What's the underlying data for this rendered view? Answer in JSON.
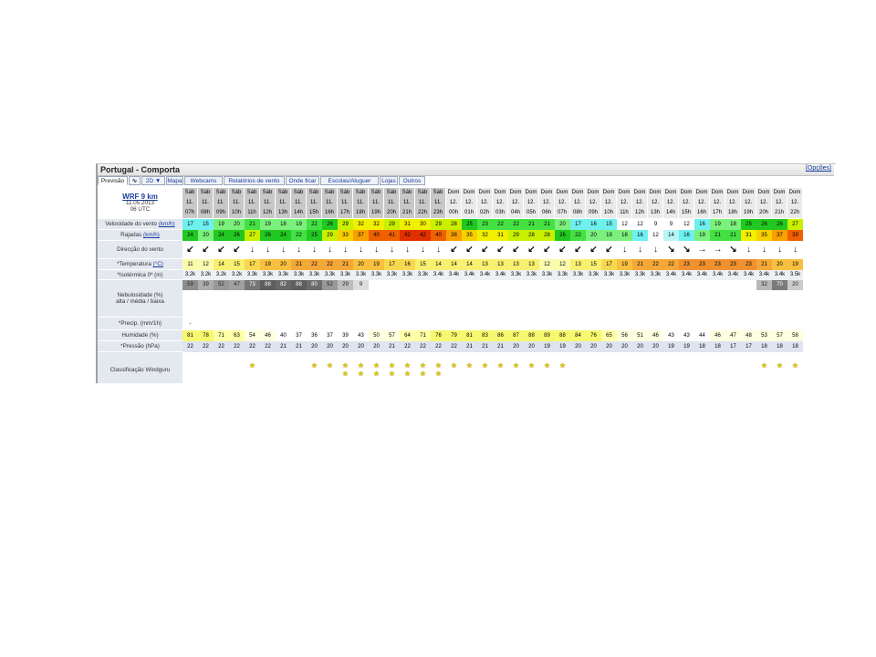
{
  "window": {
    "title": "Portugal - Comporta",
    "options_link": "[Opções]"
  },
  "tabs": [
    "Previsão",
    "",
    "2D ▼",
    "Mapa",
    "Webcams",
    "Relatórios de vento",
    "Onde ficar",
    "Escolas/Aluguer",
    "Lojas",
    "Outros"
  ],
  "model": {
    "name": "WRF 9 km",
    "date": "11.05.2013",
    "utc": "06 UTC"
  },
  "row_labels": {
    "wind_speed": "Velocidade do vento",
    "wind_unit": "(km/h)",
    "gusts": "Rajadas",
    "gust_unit": "(km/h)",
    "direction": "Direcção do vento",
    "temperature": "*Temperatura",
    "temp_unit": "(°C)",
    "isotherm": "*Isotérmica 0º (m)",
    "clouds": "Nebulosidade (%)",
    "clouds_sub": "alta / média / baixa",
    "precip": "*Precip. (mm/1h)",
    "humidity": "Humidade (%)",
    "pressure": "*Pressão (hPa)",
    "rating": "Classificação Windguru"
  },
  "hours": [
    {
      "d": "Sáb",
      "n": "11.",
      "h": "07h"
    },
    {
      "d": "Sáb",
      "n": "11.",
      "h": "08h"
    },
    {
      "d": "Sáb",
      "n": "11.",
      "h": "09h"
    },
    {
      "d": "Sáb",
      "n": "11.",
      "h": "10h"
    },
    {
      "d": "Sáb",
      "n": "11.",
      "h": "11h"
    },
    {
      "d": "Sáb",
      "n": "11.",
      "h": "12h"
    },
    {
      "d": "Sáb",
      "n": "11.",
      "h": "13h"
    },
    {
      "d": "Sáb",
      "n": "11.",
      "h": "14h"
    },
    {
      "d": "Sáb",
      "n": "11.",
      "h": "15h"
    },
    {
      "d": "Sáb",
      "n": "11.",
      "h": "16h"
    },
    {
      "d": "Sáb",
      "n": "11.",
      "h": "17h"
    },
    {
      "d": "Sáb",
      "n": "11.",
      "h": "18h"
    },
    {
      "d": "Sáb",
      "n": "11.",
      "h": "19h"
    },
    {
      "d": "Sáb",
      "n": "11.",
      "h": "20h"
    },
    {
      "d": "Sáb",
      "n": "11.",
      "h": "21h"
    },
    {
      "d": "Sáb",
      "n": "11.",
      "h": "22h"
    },
    {
      "d": "Sáb",
      "n": "11.",
      "h": "23h"
    },
    {
      "d": "Dom",
      "n": "12.",
      "h": "00h"
    },
    {
      "d": "Dom",
      "n": "12.",
      "h": "01h"
    },
    {
      "d": "Dom",
      "n": "12.",
      "h": "02h"
    },
    {
      "d": "Dom",
      "n": "12.",
      "h": "03h"
    },
    {
      "d": "Dom",
      "n": "12.",
      "h": "04h"
    },
    {
      "d": "Dom",
      "n": "12.",
      "h": "05h"
    },
    {
      "d": "Dom",
      "n": "12.",
      "h": "06h"
    },
    {
      "d": "Dom",
      "n": "12.",
      "h": "07h"
    },
    {
      "d": "Dom",
      "n": "12.",
      "h": "08h"
    },
    {
      "d": "Dom",
      "n": "12.",
      "h": "09h"
    },
    {
      "d": "Dom",
      "n": "12.",
      "h": "10h"
    },
    {
      "d": "Dom",
      "n": "12.",
      "h": "11h"
    },
    {
      "d": "Dom",
      "n": "12.",
      "h": "12h"
    },
    {
      "d": "Dom",
      "n": "12.",
      "h": "13h"
    },
    {
      "d": "Dom",
      "n": "12.",
      "h": "14h"
    },
    {
      "d": "Dom",
      "n": "12.",
      "h": "15h"
    },
    {
      "d": "Dom",
      "n": "12.",
      "h": "16h"
    },
    {
      "d": "Dom",
      "n": "12.",
      "h": "17h"
    },
    {
      "d": "Dom",
      "n": "12.",
      "h": "18h"
    },
    {
      "d": "Dom",
      "n": "12.",
      "h": "19h"
    },
    {
      "d": "Dom",
      "n": "12.",
      "h": "20h"
    },
    {
      "d": "Dom",
      "n": "12.",
      "h": "21h"
    },
    {
      "d": "Dom",
      "n": "12.",
      "h": "22h"
    }
  ],
  "wind_speed": [
    "17",
    "15",
    "19",
    "20",
    "21",
    "19",
    "18",
    "19",
    "22",
    "26",
    "29",
    "32",
    "32",
    "29",
    "31",
    "30",
    "29",
    "28",
    "25",
    "23",
    "22",
    "22",
    "21",
    "21",
    "20",
    "17",
    "16",
    "15",
    "12",
    "12",
    "9",
    "9",
    "12",
    "16",
    "19",
    "18",
    "25",
    "26",
    "26",
    "27"
  ],
  "gusts": [
    "24",
    "20",
    "24",
    "26",
    "27",
    "26",
    "24",
    "22",
    "25",
    "29",
    "33",
    "37",
    "40",
    "41",
    "42",
    "42",
    "40",
    "38",
    "35",
    "32",
    "31",
    "29",
    "28",
    "28",
    "26",
    "22",
    "20",
    "19",
    "18",
    "16",
    "12",
    "14",
    "16",
    "19",
    "21",
    "21",
    "31",
    "35",
    "37",
    "39"
  ],
  "direction": [
    "↙",
    "↙",
    "↙",
    "↙",
    "↓",
    "↓",
    "↓",
    "↓",
    "↓",
    "↓",
    "↓",
    "↓",
    "↓",
    "↓",
    "↓",
    "↓",
    "↓",
    "↙",
    "↙",
    "↙",
    "↙",
    "↙",
    "↙",
    "↙",
    "↙",
    "↙",
    "↙",
    "↙",
    "↓",
    "↓",
    "↓",
    "↘",
    "↘",
    "→",
    "→",
    "↘",
    "↓",
    "↓",
    "↓",
    "↓"
  ],
  "temperature": [
    "11",
    "12",
    "14",
    "15",
    "17",
    "19",
    "20",
    "21",
    "22",
    "22",
    "21",
    "20",
    "19",
    "17",
    "16",
    "15",
    "14",
    "14",
    "14",
    "13",
    "13",
    "13",
    "13",
    "12",
    "12",
    "13",
    "15",
    "17",
    "19",
    "21",
    "22",
    "22",
    "23",
    "23",
    "23",
    "23",
    "23",
    "21",
    "20",
    "19"
  ],
  "isotherm": [
    "3.2k",
    "3.2k",
    "3.2k",
    "3.2k",
    "3.3k",
    "3.3k",
    "3.3k",
    "3.3k",
    "3.3k",
    "3.3k",
    "3.3k",
    "3.3k",
    "3.3k",
    "3.3k",
    "3.3k",
    "3.3k",
    "3.4k",
    "3.4k",
    "3.4k",
    "3.4k",
    "3.4k",
    "3.3k",
    "3.3k",
    "3.3k",
    "3.3k",
    "3.3k",
    "3.3k",
    "3.3k",
    "3.3k",
    "3.3k",
    "3.3k",
    "3.4k",
    "3.4k",
    "3.4k",
    "3.4k",
    "3.4k",
    "3.4k",
    "3.4k",
    "3.4k",
    "3.5k"
  ],
  "clouds": [
    "59",
    "39",
    "52",
    "47",
    "73",
    "88",
    "82",
    "88",
    "80",
    "52",
    "29",
    "9",
    "",
    "",
    "",
    "",
    "",
    "",
    "",
    "",
    "",
    "",
    "",
    "",
    "",
    "",
    "",
    "",
    "",
    "",
    "",
    "",
    "",
    "",
    "",
    "",
    "",
    "32",
    "70",
    "20"
  ],
  "precip": [
    "-",
    "",
    "",
    "",
    "",
    "",
    "",
    "",
    "",
    "",
    "",
    "",
    "",
    "",
    "",
    "",
    "",
    "",
    "",
    "",
    "",
    "",
    "",
    "",
    "",
    "",
    "",
    "",
    "",
    "",
    "",
    "",
    "",
    "",
    "",
    "",
    "",
    "",
    "",
    ""
  ],
  "humidity": [
    "81",
    "78",
    "71",
    "63",
    "54",
    "46",
    "40",
    "37",
    "36",
    "37",
    "39",
    "43",
    "50",
    "57",
    "64",
    "71",
    "76",
    "79",
    "81",
    "83",
    "86",
    "87",
    "88",
    "89",
    "88",
    "84",
    "76",
    "65",
    "56",
    "51",
    "46",
    "43",
    "43",
    "44",
    "46",
    "47",
    "48",
    "53",
    "57",
    "58"
  ],
  "pressure": [
    "22",
    "22",
    "22",
    "22",
    "22",
    "22",
    "21",
    "21",
    "20",
    "20",
    "20",
    "20",
    "20",
    "21",
    "22",
    "22",
    "22",
    "22",
    "21",
    "21",
    "21",
    "20",
    "20",
    "19",
    "19",
    "20",
    "20",
    "20",
    "20",
    "20",
    "20",
    "19",
    "19",
    "18",
    "18",
    "17",
    "17",
    "18",
    "18",
    "18"
  ],
  "rating_stars": [
    0,
    0,
    0,
    0,
    1,
    0,
    0,
    0,
    1,
    1,
    2,
    2,
    2,
    2,
    2,
    2,
    2,
    1,
    1,
    1,
    1,
    1,
    1,
    1,
    1,
    0,
    0,
    0,
    0,
    0,
    0,
    0,
    0,
    0,
    0,
    0,
    0,
    1,
    1,
    1
  ],
  "colors": {
    "header_sat": "#c8c8c8",
    "header_sun": "#eaeaea",
    "label_bg": "#e4e8ef",
    "link": "#1a3ea0",
    "star": "#e3c800"
  }
}
